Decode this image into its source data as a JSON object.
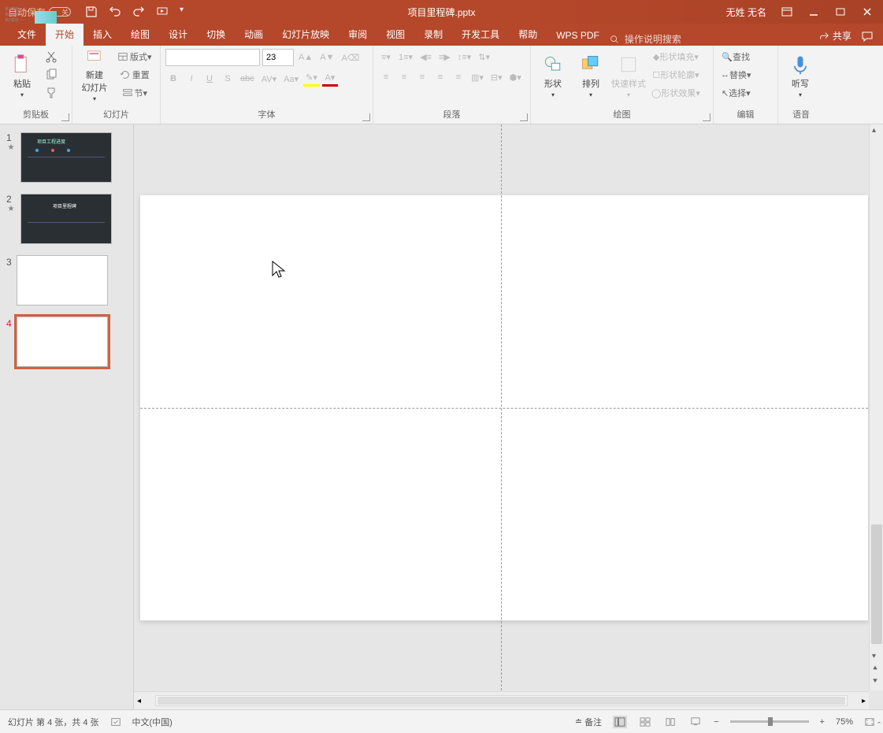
{
  "titlebar": {
    "autosave_label": "自动保存",
    "autosave_state": "关",
    "filename": "项目里程碑.pptx",
    "username": "无姓 无名"
  },
  "tabs": {
    "file": "文件",
    "home": "开始",
    "insert": "插入",
    "draw": "绘图",
    "design": "设计",
    "transitions": "切换",
    "animations": "动画",
    "slideshow": "幻灯片放映",
    "review": "审阅",
    "view": "视图",
    "record": "录制",
    "developer": "开发工具",
    "help": "帮助",
    "wps": "WPS PDF",
    "search_placeholder": "操作说明搜索",
    "share": "共享"
  },
  "ribbon": {
    "clipboard": {
      "label": "剪贴板",
      "paste": "粘贴"
    },
    "slides": {
      "label": "幻灯片",
      "new_slide": "新建\n幻灯片",
      "layout": "版式",
      "reset": "重置",
      "section": "节"
    },
    "font": {
      "label": "字体",
      "size": "23"
    },
    "paragraph": {
      "label": "段落"
    },
    "drawing": {
      "label": "绘图",
      "shapes": "形状",
      "arrange": "排列",
      "quickstyles": "快速样式",
      "fill": "形状填充",
      "outline": "形状轮廓",
      "effects": "形状效果"
    },
    "editing": {
      "label": "编辑",
      "find": "查找",
      "replace": "替换",
      "select": "选择"
    },
    "voice": {
      "label": "语音",
      "dictate": "听写"
    }
  },
  "thumbs": {
    "items": [
      {
        "num": "1"
      },
      {
        "num": "2"
      },
      {
        "num": "3"
      },
      {
        "num": "4"
      }
    ]
  },
  "statusbar": {
    "slide_info": "幻灯片 第 4 张，共 4 张",
    "language": "中文(中国)",
    "notes": "备注",
    "zoom": "75%"
  }
}
